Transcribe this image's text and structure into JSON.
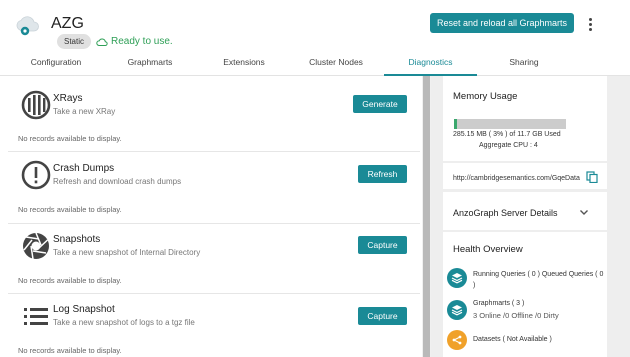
{
  "header": {
    "title": "AZG",
    "badge": "Static",
    "status": "Ready to use.",
    "reset_button": "Reset and reload all Graphmarts"
  },
  "tabs": [
    {
      "label": "Configuration",
      "active": false
    },
    {
      "label": "Graphmarts",
      "active": false
    },
    {
      "label": "Extensions",
      "active": false
    },
    {
      "label": "Cluster Nodes",
      "active": false
    },
    {
      "label": "Diagnostics",
      "active": true
    },
    {
      "label": "Sharing",
      "active": false
    }
  ],
  "cards": [
    {
      "title": "XRays",
      "subtitle": "Take a new XRay",
      "button": "Generate",
      "empty": "No records available to display.",
      "icon": "xray-icon"
    },
    {
      "title": "Crash Dumps",
      "subtitle": "Refresh and download crash dumps",
      "button": "Refresh",
      "empty": "No records available to display.",
      "icon": "alert-circle-icon"
    },
    {
      "title": "Snapshots",
      "subtitle": "Take a new snapshot of Internal Directory",
      "button": "Capture",
      "empty": "No records available to display.",
      "icon": "camera-shutter-icon"
    },
    {
      "title": "Log Snapshot",
      "subtitle": "Take a new snapshot of logs to a tgz file",
      "button": "Capture",
      "empty": "No records available to display.",
      "icon": "list-icon"
    }
  ],
  "memory": {
    "title": "Memory Usage",
    "used_percent": 3,
    "usage_text": "285.15 MB ( 3% ) of 11.7 GB Used",
    "cpu_text": "Aggregate CPU : 4"
  },
  "endpoint": {
    "url": "http://cambridgesemantics.com/GqeData"
  },
  "details": {
    "title": "AnzoGraph Server Details"
  },
  "health": {
    "title": "Health Overview",
    "queries_label": "Running Queries ( 0 ) Queued Queries ( 0 )",
    "graphmarts_label": "Graphmarts ( 3 )",
    "graphmarts_sub": "3 Online /0 Offline /0 Dirty",
    "datasets_label": "Datasets ( Not Available )"
  },
  "colors": {
    "accent": "#1a8a96",
    "ok": "#2e9f56",
    "warn": "#f0a12a"
  }
}
